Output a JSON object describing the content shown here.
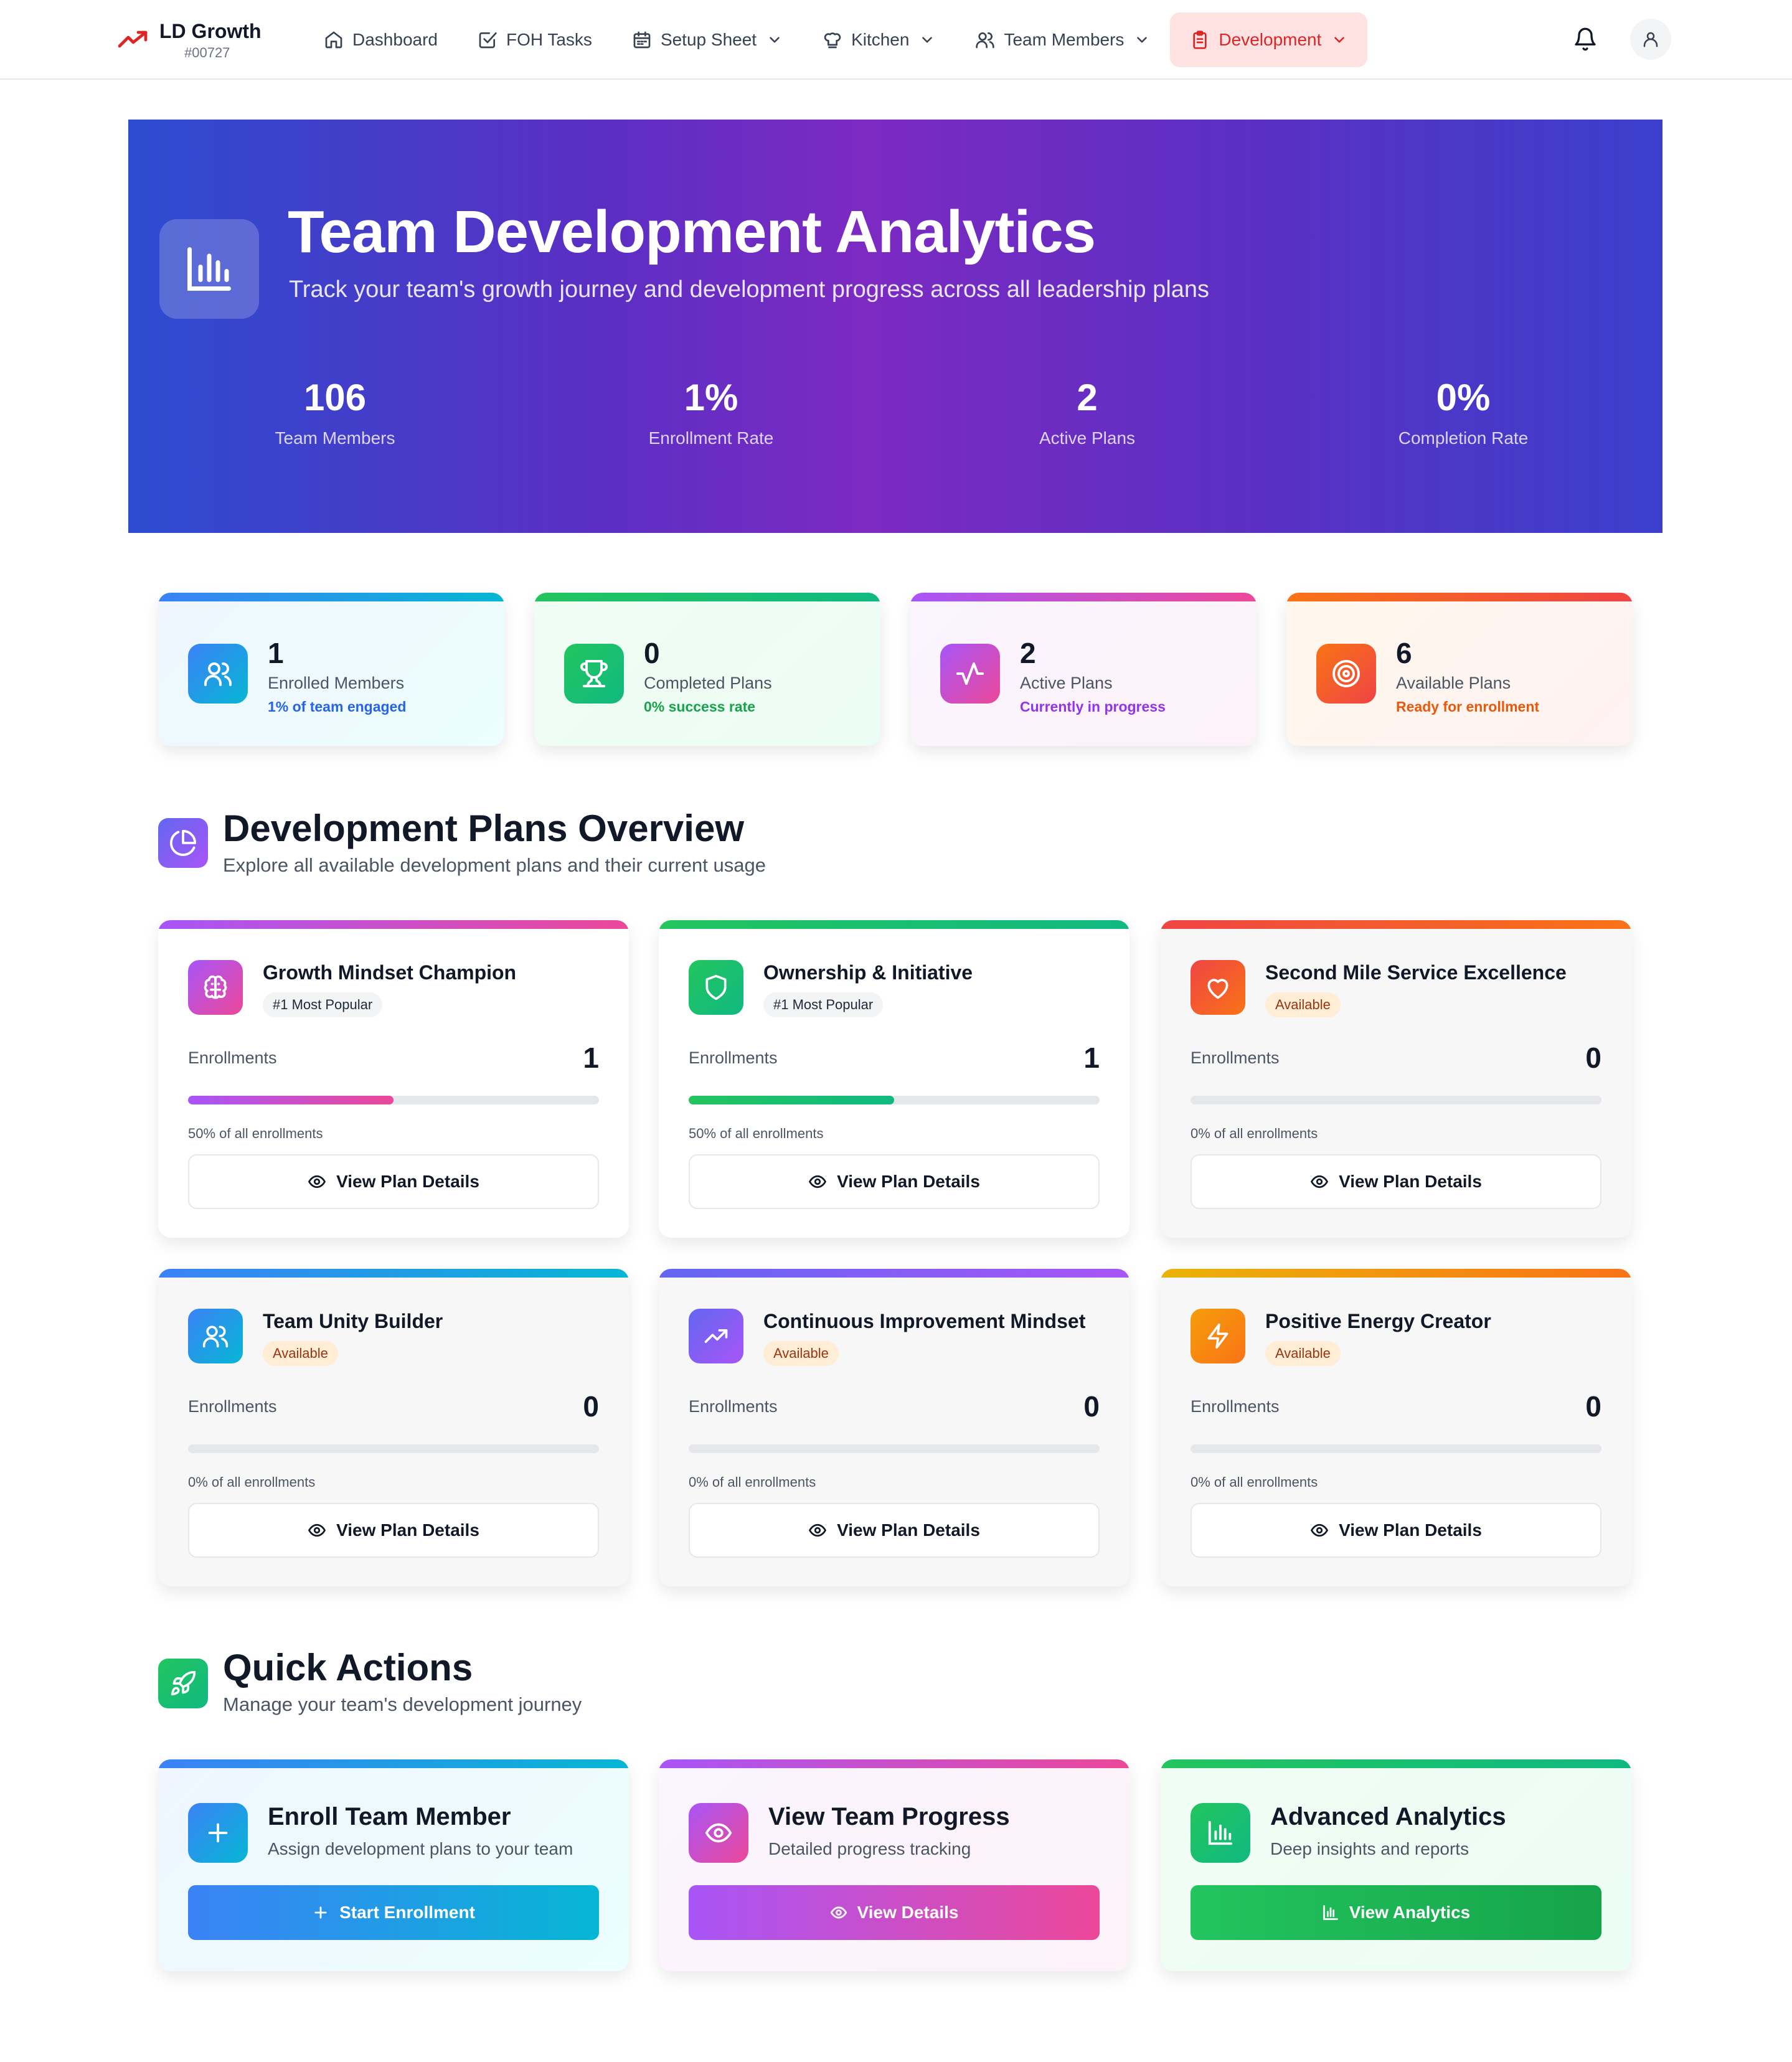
{
  "nav": {
    "brand_name": "LD Growth",
    "brand_code": "#00727",
    "items": [
      {
        "label": "Dashboard",
        "icon": "home-icon"
      },
      {
        "label": "FOH Tasks",
        "icon": "checkbox-icon"
      },
      {
        "label": "Setup Sheet",
        "icon": "calendar-icon",
        "dropdown": true
      },
      {
        "label": "Kitchen",
        "icon": "chef-hat-icon",
        "dropdown": true
      },
      {
        "label": "Team Members",
        "icon": "users-icon",
        "dropdown": true
      },
      {
        "label": "Development",
        "icon": "clipboard-icon",
        "dropdown": true,
        "active": true
      }
    ]
  },
  "hero": {
    "title": "Team Development Analytics",
    "subtitle": "Track your team's growth journey and development progress across all leadership plans",
    "stats": [
      {
        "value": "106",
        "label": "Team Members"
      },
      {
        "value": "1%",
        "label": "Enrollment Rate"
      },
      {
        "value": "2",
        "label": "Active Plans"
      },
      {
        "value": "0%",
        "label": "Completion Rate"
      }
    ]
  },
  "stat_cards": [
    {
      "value": "1",
      "label": "Enrolled Members",
      "sub": "1% of team engaged",
      "icon": "users-icon",
      "sub_color": "#2563eb"
    },
    {
      "value": "0",
      "label": "Completed Plans",
      "sub": "0% success rate",
      "icon": "trophy-icon",
      "sub_color": "#16a34a"
    },
    {
      "value": "2",
      "label": "Active Plans",
      "sub": "Currently in progress",
      "icon": "activity-icon",
      "sub_color": "#9333ea"
    },
    {
      "value": "6",
      "label": "Available Plans",
      "sub": "Ready for enrollment",
      "icon": "target-icon",
      "sub_color": "#ea580c"
    }
  ],
  "plans_section": {
    "title": "Development Plans Overview",
    "subtitle": "Explore all available development plans and their current usage",
    "enrollments_label": "Enrollments",
    "button_label": "View Plan Details"
  },
  "plans": [
    {
      "name": "Growth Mindset Champion",
      "badge": "#1 Most Popular",
      "enrollments": "1",
      "share": 0.5,
      "pct_label": "50% of all enrollments",
      "icon": "brain-icon"
    },
    {
      "name": "Ownership & Initiative",
      "badge": "#1 Most Popular",
      "enrollments": "1",
      "share": 0.5,
      "pct_label": "50% of all enrollments",
      "icon": "shield-icon"
    },
    {
      "name": "Second Mile Service Excellence",
      "badge": "Available",
      "enrollments": "0",
      "share": 0,
      "pct_label": "0% of all enrollments",
      "icon": "heart-icon"
    },
    {
      "name": "Team Unity Builder",
      "badge": "Available",
      "enrollments": "0",
      "share": 0,
      "pct_label": "0% of all enrollments",
      "icon": "users-icon"
    },
    {
      "name": "Continuous Improvement Mindset",
      "badge": "Available",
      "enrollments": "0",
      "share": 0,
      "pct_label": "0% of all enrollments",
      "icon": "trending-up-icon"
    },
    {
      "name": "Positive Energy Creator",
      "badge": "Available",
      "enrollments": "0",
      "share": 0,
      "pct_label": "0% of all enrollments",
      "icon": "zap-icon"
    }
  ],
  "quick_actions": {
    "title": "Quick Actions",
    "subtitle": "Manage your team's development journey",
    "items": [
      {
        "title": "Enroll Team Member",
        "subtitle": "Assign development plans to your team",
        "button": "Start Enrollment",
        "icon": "plus-icon"
      },
      {
        "title": "View Team Progress",
        "subtitle": "Detailed progress tracking",
        "button": "View Details",
        "icon": "eye-icon"
      },
      {
        "title": "Advanced Analytics",
        "subtitle": "Deep insights and reports",
        "button": "View Analytics",
        "icon": "bar-chart-icon"
      }
    ]
  },
  "colors": {
    "accent_red": "#dc2626",
    "blue": "#3b82f6",
    "green": "#22c55e",
    "purple": "#a855f7",
    "pink": "#ec4899",
    "orange": "#f97316"
  }
}
